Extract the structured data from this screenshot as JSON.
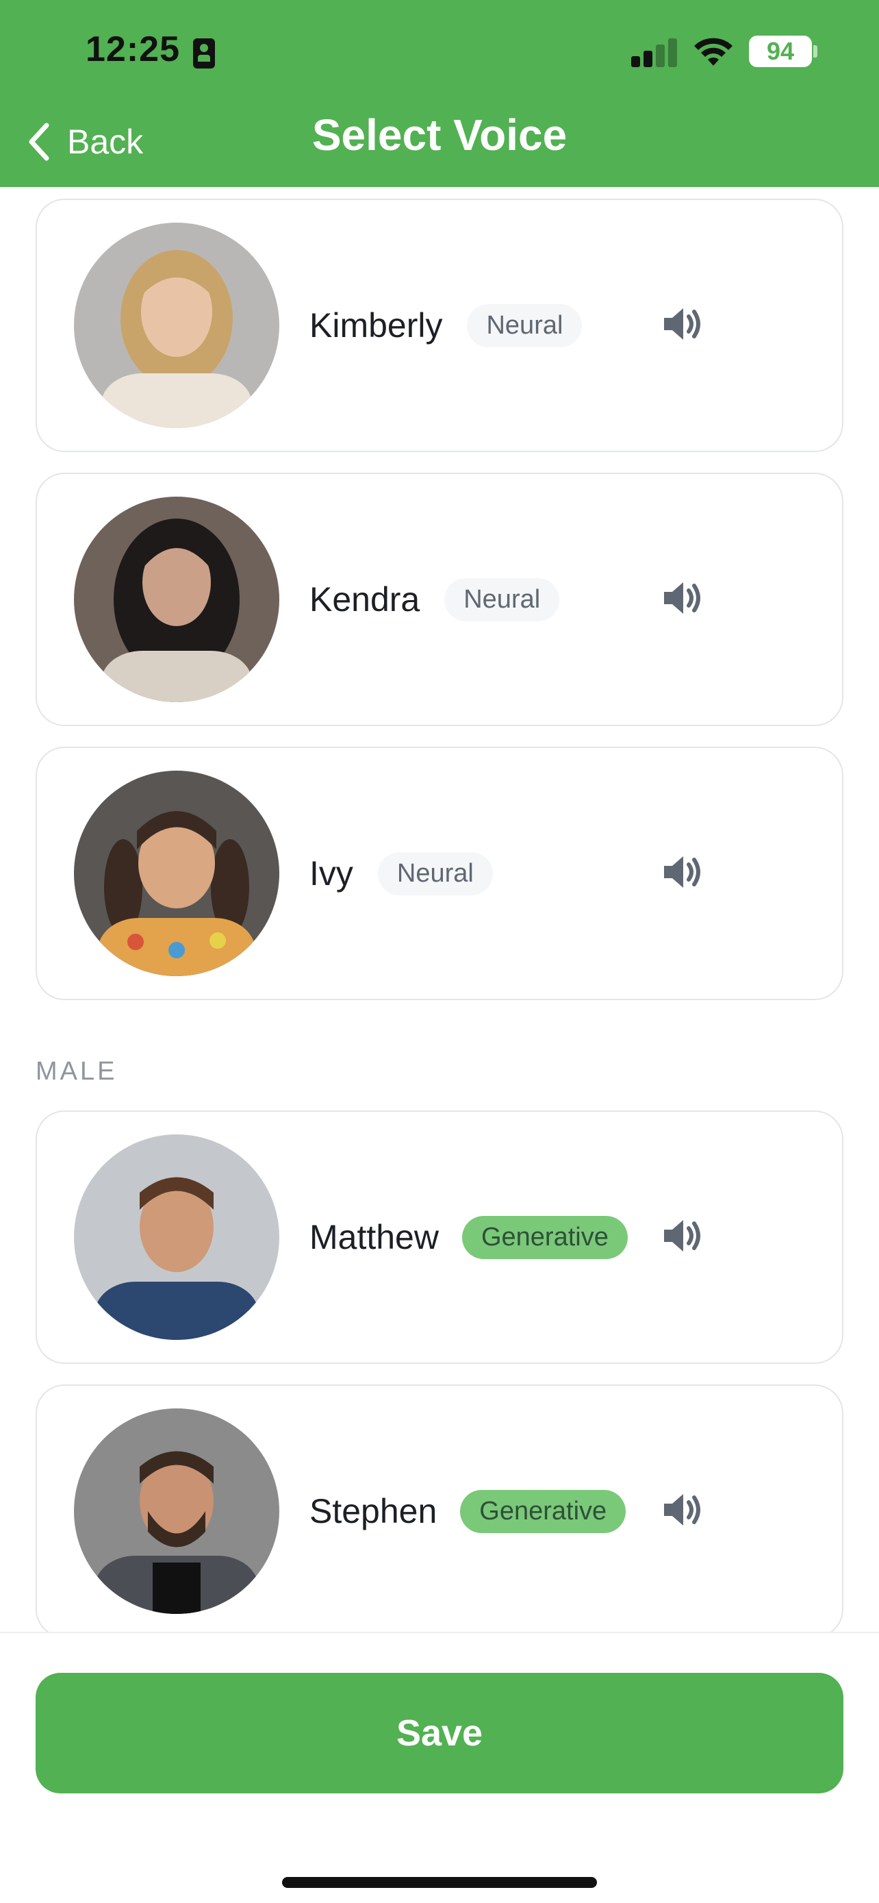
{
  "status_bar": {
    "time": "12:25",
    "battery": "94"
  },
  "header": {
    "back_label": "Back",
    "title": "Select Voice"
  },
  "voices_top": [
    {
      "name": "Kimberly",
      "badge": "Neural"
    },
    {
      "name": "Kendra",
      "badge": "Neural"
    },
    {
      "name": "Ivy",
      "badge": "Neural"
    }
  ],
  "male_section": {
    "label": "MALE",
    "voices": [
      {
        "name": "Matthew",
        "badge": "Generative"
      },
      {
        "name": "Stephen",
        "badge": "Generative"
      }
    ]
  },
  "footer": {
    "save_label": "Save"
  },
  "colors": {
    "brand_green": "#52b152",
    "generative_badge": "#7ac978",
    "neural_badge": "#f4f6f8"
  },
  "icons": [
    "back-chevron-icon",
    "speaker-icon",
    "signal-icon",
    "wifi-icon",
    "battery-icon"
  ]
}
